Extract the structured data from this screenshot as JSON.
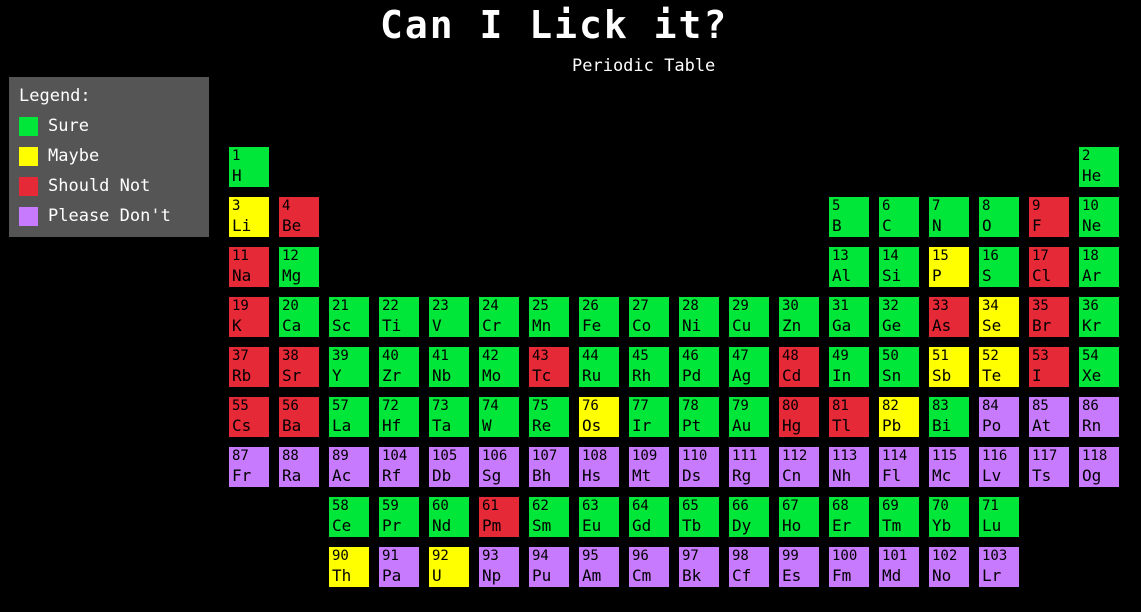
{
  "header": {
    "title": "Can I Lick it?",
    "subtitle": "Periodic Table"
  },
  "legend": {
    "title": "Legend:",
    "items": [
      {
        "key": "sure",
        "label": "Sure",
        "color": "#00e639"
      },
      {
        "key": "maybe",
        "label": "Maybe",
        "color": "#ffff00"
      },
      {
        "key": "should_not",
        "label": "Should Not",
        "color": "#e62937"
      },
      {
        "key": "please_dont",
        "label": "Please Don't",
        "color": "#c87aff"
      }
    ]
  },
  "colors": {
    "S": "#00e639",
    "M": "#ffff00",
    "N": "#e62937",
    "P": "#c87aff"
  },
  "elements": [
    {
      "n": "1",
      "s": "H",
      "c": "S",
      "row": 1,
      "col": 1
    },
    {
      "n": "2",
      "s": "He",
      "c": "S",
      "row": 1,
      "col": 18
    },
    {
      "n": "3",
      "s": "Li",
      "c": "M",
      "row": 2,
      "col": 1
    },
    {
      "n": "4",
      "s": "Be",
      "c": "N",
      "row": 2,
      "col": 2
    },
    {
      "n": "5",
      "s": "B",
      "c": "S",
      "row": 2,
      "col": 13
    },
    {
      "n": "6",
      "s": "C",
      "c": "S",
      "row": 2,
      "col": 14
    },
    {
      "n": "7",
      "s": "N",
      "c": "S",
      "row": 2,
      "col": 15
    },
    {
      "n": "8",
      "s": "O",
      "c": "S",
      "row": 2,
      "col": 16
    },
    {
      "n": "9",
      "s": "F",
      "c": "N",
      "row": 2,
      "col": 17
    },
    {
      "n": "10",
      "s": "Ne",
      "c": "S",
      "row": 2,
      "col": 18
    },
    {
      "n": "11",
      "s": "Na",
      "c": "N",
      "row": 3,
      "col": 1
    },
    {
      "n": "12",
      "s": "Mg",
      "c": "S",
      "row": 3,
      "col": 2
    },
    {
      "n": "13",
      "s": "Al",
      "c": "S",
      "row": 3,
      "col": 13
    },
    {
      "n": "14",
      "s": "Si",
      "c": "S",
      "row": 3,
      "col": 14
    },
    {
      "n": "15",
      "s": "P",
      "c": "M",
      "row": 3,
      "col": 15
    },
    {
      "n": "16",
      "s": "S",
      "c": "S",
      "row": 3,
      "col": 16
    },
    {
      "n": "17",
      "s": "Cl",
      "c": "N",
      "row": 3,
      "col": 17
    },
    {
      "n": "18",
      "s": "Ar",
      "c": "S",
      "row": 3,
      "col": 18
    },
    {
      "n": "19",
      "s": "K",
      "c": "N",
      "row": 4,
      "col": 1
    },
    {
      "n": "20",
      "s": "Ca",
      "c": "S",
      "row": 4,
      "col": 2
    },
    {
      "n": "21",
      "s": "Sc",
      "c": "S",
      "row": 4,
      "col": 3
    },
    {
      "n": "22",
      "s": "Ti",
      "c": "S",
      "row": 4,
      "col": 4
    },
    {
      "n": "23",
      "s": "V",
      "c": "S",
      "row": 4,
      "col": 5
    },
    {
      "n": "24",
      "s": "Cr",
      "c": "S",
      "row": 4,
      "col": 6
    },
    {
      "n": "25",
      "s": "Mn",
      "c": "S",
      "row": 4,
      "col": 7
    },
    {
      "n": "26",
      "s": "Fe",
      "c": "S",
      "row": 4,
      "col": 8
    },
    {
      "n": "27",
      "s": "Co",
      "c": "S",
      "row": 4,
      "col": 9
    },
    {
      "n": "28",
      "s": "Ni",
      "c": "S",
      "row": 4,
      "col": 10
    },
    {
      "n": "29",
      "s": "Cu",
      "c": "S",
      "row": 4,
      "col": 11
    },
    {
      "n": "30",
      "s": "Zn",
      "c": "S",
      "row": 4,
      "col": 12
    },
    {
      "n": "31",
      "s": "Ga",
      "c": "S",
      "row": 4,
      "col": 13
    },
    {
      "n": "32",
      "s": "Ge",
      "c": "S",
      "row": 4,
      "col": 14
    },
    {
      "n": "33",
      "s": "As",
      "c": "N",
      "row": 4,
      "col": 15
    },
    {
      "n": "34",
      "s": "Se",
      "c": "M",
      "row": 4,
      "col": 16
    },
    {
      "n": "35",
      "s": "Br",
      "c": "N",
      "row": 4,
      "col": 17
    },
    {
      "n": "36",
      "s": "Kr",
      "c": "S",
      "row": 4,
      "col": 18
    },
    {
      "n": "37",
      "s": "Rb",
      "c": "N",
      "row": 5,
      "col": 1
    },
    {
      "n": "38",
      "s": "Sr",
      "c": "N",
      "row": 5,
      "col": 2
    },
    {
      "n": "39",
      "s": "Y",
      "c": "S",
      "row": 5,
      "col": 3
    },
    {
      "n": "40",
      "s": "Zr",
      "c": "S",
      "row": 5,
      "col": 4
    },
    {
      "n": "41",
      "s": "Nb",
      "c": "S",
      "row": 5,
      "col": 5
    },
    {
      "n": "42",
      "s": "Mo",
      "c": "S",
      "row": 5,
      "col": 6
    },
    {
      "n": "43",
      "s": "Tc",
      "c": "N",
      "row": 5,
      "col": 7
    },
    {
      "n": "44",
      "s": "Ru",
      "c": "S",
      "row": 5,
      "col": 8
    },
    {
      "n": "45",
      "s": "Rh",
      "c": "S",
      "row": 5,
      "col": 9
    },
    {
      "n": "46",
      "s": "Pd",
      "c": "S",
      "row": 5,
      "col": 10
    },
    {
      "n": "47",
      "s": "Ag",
      "c": "S",
      "row": 5,
      "col": 11
    },
    {
      "n": "48",
      "s": "Cd",
      "c": "N",
      "row": 5,
      "col": 12
    },
    {
      "n": "49",
      "s": "In",
      "c": "S",
      "row": 5,
      "col": 13
    },
    {
      "n": "50",
      "s": "Sn",
      "c": "S",
      "row": 5,
      "col": 14
    },
    {
      "n": "51",
      "s": "Sb",
      "c": "M",
      "row": 5,
      "col": 15
    },
    {
      "n": "52",
      "s": "Te",
      "c": "M",
      "row": 5,
      "col": 16
    },
    {
      "n": "53",
      "s": "I",
      "c": "N",
      "row": 5,
      "col": 17
    },
    {
      "n": "54",
      "s": "Xe",
      "c": "S",
      "row": 5,
      "col": 18
    },
    {
      "n": "55",
      "s": "Cs",
      "c": "N",
      "row": 6,
      "col": 1
    },
    {
      "n": "56",
      "s": "Ba",
      "c": "N",
      "row": 6,
      "col": 2
    },
    {
      "n": "57",
      "s": "La",
      "c": "S",
      "row": 6,
      "col": 3
    },
    {
      "n": "72",
      "s": "Hf",
      "c": "S",
      "row": 6,
      "col": 4
    },
    {
      "n": "73",
      "s": "Ta",
      "c": "S",
      "row": 6,
      "col": 5
    },
    {
      "n": "74",
      "s": "W",
      "c": "S",
      "row": 6,
      "col": 6
    },
    {
      "n": "75",
      "s": "Re",
      "c": "S",
      "row": 6,
      "col": 7
    },
    {
      "n": "76",
      "s": "Os",
      "c": "M",
      "row": 6,
      "col": 8
    },
    {
      "n": "77",
      "s": "Ir",
      "c": "S",
      "row": 6,
      "col": 9
    },
    {
      "n": "78",
      "s": "Pt",
      "c": "S",
      "row": 6,
      "col": 10
    },
    {
      "n": "79",
      "s": "Au",
      "c": "S",
      "row": 6,
      "col": 11
    },
    {
      "n": "80",
      "s": "Hg",
      "c": "N",
      "row": 6,
      "col": 12
    },
    {
      "n": "81",
      "s": "Tl",
      "c": "N",
      "row": 6,
      "col": 13
    },
    {
      "n": "82",
      "s": "Pb",
      "c": "M",
      "row": 6,
      "col": 14
    },
    {
      "n": "83",
      "s": "Bi",
      "c": "S",
      "row": 6,
      "col": 15
    },
    {
      "n": "84",
      "s": "Po",
      "c": "P",
      "row": 6,
      "col": 16
    },
    {
      "n": "85",
      "s": "At",
      "c": "P",
      "row": 6,
      "col": 17
    },
    {
      "n": "86",
      "s": "Rn",
      "c": "P",
      "row": 6,
      "col": 18
    },
    {
      "n": "87",
      "s": "Fr",
      "c": "P",
      "row": 7,
      "col": 1
    },
    {
      "n": "88",
      "s": "Ra",
      "c": "P",
      "row": 7,
      "col": 2
    },
    {
      "n": "89",
      "s": "Ac",
      "c": "P",
      "row": 7,
      "col": 3
    },
    {
      "n": "104",
      "s": "Rf",
      "c": "P",
      "row": 7,
      "col": 4
    },
    {
      "n": "105",
      "s": "Db",
      "c": "P",
      "row": 7,
      "col": 5
    },
    {
      "n": "106",
      "s": "Sg",
      "c": "P",
      "row": 7,
      "col": 6
    },
    {
      "n": "107",
      "s": "Bh",
      "c": "P",
      "row": 7,
      "col": 7
    },
    {
      "n": "108",
      "s": "Hs",
      "c": "P",
      "row": 7,
      "col": 8
    },
    {
      "n": "109",
      "s": "Mt",
      "c": "P",
      "row": 7,
      "col": 9
    },
    {
      "n": "110",
      "s": "Ds",
      "c": "P",
      "row": 7,
      "col": 10
    },
    {
      "n": "111",
      "s": "Rg",
      "c": "P",
      "row": 7,
      "col": 11
    },
    {
      "n": "112",
      "s": "Cn",
      "c": "P",
      "row": 7,
      "col": 12
    },
    {
      "n": "113",
      "s": "Nh",
      "c": "P",
      "row": 7,
      "col": 13
    },
    {
      "n": "114",
      "s": "Fl",
      "c": "P",
      "row": 7,
      "col": 14
    },
    {
      "n": "115",
      "s": "Mc",
      "c": "P",
      "row": 7,
      "col": 15
    },
    {
      "n": "116",
      "s": "Lv",
      "c": "P",
      "row": 7,
      "col": 16
    },
    {
      "n": "117",
      "s": "Ts",
      "c": "P",
      "row": 7,
      "col": 17
    },
    {
      "n": "118",
      "s": "Og",
      "c": "P",
      "row": 7,
      "col": 18
    },
    {
      "n": "58",
      "s": "Ce",
      "c": "S",
      "row": 8,
      "col": 3
    },
    {
      "n": "59",
      "s": "Pr",
      "c": "S",
      "row": 8,
      "col": 4
    },
    {
      "n": "60",
      "s": "Nd",
      "c": "S",
      "row": 8,
      "col": 5
    },
    {
      "n": "61",
      "s": "Pm",
      "c": "N",
      "row": 8,
      "col": 6
    },
    {
      "n": "62",
      "s": "Sm",
      "c": "S",
      "row": 8,
      "col": 7
    },
    {
      "n": "63",
      "s": "Eu",
      "c": "S",
      "row": 8,
      "col": 8
    },
    {
      "n": "64",
      "s": "Gd",
      "c": "S",
      "row": 8,
      "col": 9
    },
    {
      "n": "65",
      "s": "Tb",
      "c": "S",
      "row": 8,
      "col": 10
    },
    {
      "n": "66",
      "s": "Dy",
      "c": "S",
      "row": 8,
      "col": 11
    },
    {
      "n": "67",
      "s": "Ho",
      "c": "S",
      "row": 8,
      "col": 12
    },
    {
      "n": "68",
      "s": "Er",
      "c": "S",
      "row": 8,
      "col": 13
    },
    {
      "n": "69",
      "s": "Tm",
      "c": "S",
      "row": 8,
      "col": 14
    },
    {
      "n": "70",
      "s": "Yb",
      "c": "S",
      "row": 8,
      "col": 15
    },
    {
      "n": "71",
      "s": "Lu",
      "c": "S",
      "row": 8,
      "col": 16
    },
    {
      "n": "90",
      "s": "Th",
      "c": "M",
      "row": 9,
      "col": 3
    },
    {
      "n": "91",
      "s": "Pa",
      "c": "P",
      "row": 9,
      "col": 4
    },
    {
      "n": "92",
      "s": "U",
      "c": "M",
      "row": 9,
      "col": 5
    },
    {
      "n": "93",
      "s": "Np",
      "c": "P",
      "row": 9,
      "col": 6
    },
    {
      "n": "94",
      "s": "Pu",
      "c": "P",
      "row": 9,
      "col": 7
    },
    {
      "n": "95",
      "s": "Am",
      "c": "P",
      "row": 9,
      "col": 8
    },
    {
      "n": "96",
      "s": "Cm",
      "c": "P",
      "row": 9,
      "col": 9
    },
    {
      "n": "97",
      "s": "Bk",
      "c": "P",
      "row": 9,
      "col": 10
    },
    {
      "n": "98",
      "s": "Cf",
      "c": "P",
      "row": 9,
      "col": 11
    },
    {
      "n": "99",
      "s": "Es",
      "c": "P",
      "row": 9,
      "col": 12
    },
    {
      "n": "100",
      "s": "Fm",
      "c": "P",
      "row": 9,
      "col": 13
    },
    {
      "n": "101",
      "s": "Md",
      "c": "P",
      "row": 9,
      "col": 14
    },
    {
      "n": "102",
      "s": "No",
      "c": "P",
      "row": 9,
      "col": 15
    },
    {
      "n": "103",
      "s": "Lr",
      "c": "P",
      "row": 9,
      "col": 16
    }
  ]
}
